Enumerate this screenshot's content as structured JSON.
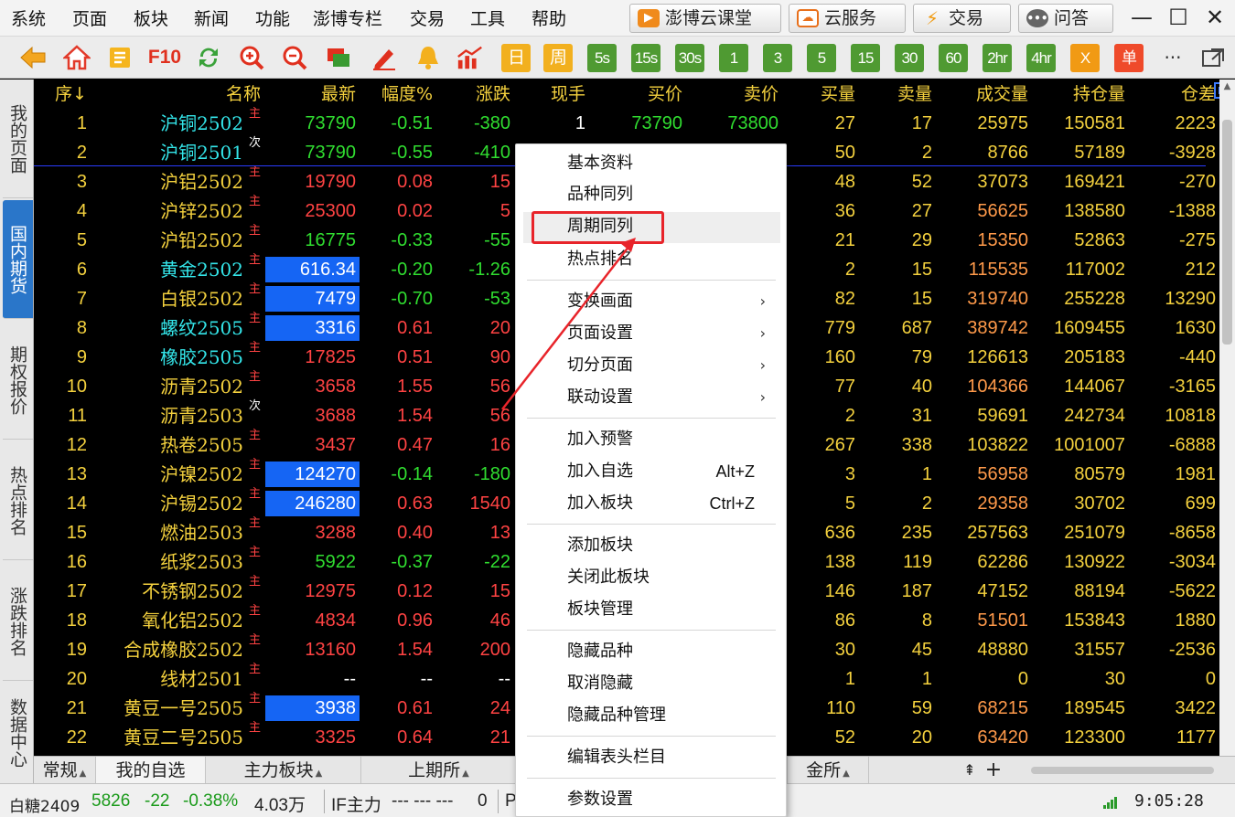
{
  "menubar": {
    "items": [
      "系统",
      "页面",
      "板块",
      "新闻",
      "功能",
      "澎博专栏",
      "交易",
      "工具",
      "帮助"
    ],
    "buttons": {
      "classroom": "澎博云课堂",
      "cloud": "云服务",
      "trade": "交易",
      "qa": "问答"
    },
    "window": {
      "minimize": "—",
      "maximize": "☐",
      "close": "✕"
    }
  },
  "toolbar": {
    "icons": [
      "back-arrow-icon",
      "home-icon",
      "news-icon",
      "f10-icon",
      "refresh-icon",
      "zoom-in-icon",
      "zoom-out-icon",
      "window-icon",
      "pen-icon",
      "alarm-bell-icon",
      "trend-icon"
    ],
    "f10": "F10",
    "periods": [
      "日",
      "周",
      "5s",
      "15s",
      "30s",
      "1",
      "3",
      "5",
      "15",
      "30",
      "60",
      "2hr",
      "4hr",
      "X",
      "单"
    ],
    "more": "···"
  },
  "sidebar": {
    "tabs": [
      "我的页面",
      "国内期货",
      "期权报价",
      "热点排名",
      "涨跌排名",
      "数据中心"
    ],
    "active": "国内期货"
  },
  "table": {
    "headers": [
      "序",
      "名称",
      "最新",
      "幅度%",
      "涨跌",
      "现手",
      "买价",
      "卖价",
      "买量",
      "卖量",
      "成交量",
      "持仓量",
      "仓差"
    ],
    "sort_indicator": "↓",
    "rows": [
      {
        "seq": "1",
        "name": "沪铜2502",
        "tag": "主",
        "last": "73790",
        "pct": "-0.51",
        "chg": "-380",
        "vol": "1",
        "bid": "73790",
        "ask": "73800",
        "bq": "27",
        "aq": "17",
        "tv": "25975",
        "oi": "150581",
        "diff": "2223"
      },
      {
        "seq": "2",
        "name": "沪铜2501",
        "tag": "次",
        "last": "73790",
        "pct": "-0.55",
        "chg": "-410",
        "vol": "",
        "bid": "",
        "ask": "",
        "bq": "50",
        "aq": "2",
        "tv": "8766",
        "oi": "57189",
        "diff": "-3928"
      },
      {
        "seq": "3",
        "name": "沪铝2502",
        "tag": "主",
        "last": "19790",
        "pct": "0.08",
        "chg": "15",
        "vol": "",
        "bid": "",
        "ask": "",
        "bq": "48",
        "aq": "52",
        "tv": "37073",
        "oi": "169421",
        "diff": "-270"
      },
      {
        "seq": "4",
        "name": "沪锌2502",
        "tag": "主",
        "last": "25300",
        "pct": "0.02",
        "chg": "5",
        "vol": "",
        "bid": "",
        "ask": "",
        "bq": "36",
        "aq": "27",
        "tv": "56625",
        "oi": "138580",
        "diff": "-1388"
      },
      {
        "seq": "5",
        "name": "沪铅2502",
        "tag": "主",
        "last": "16775",
        "pct": "-0.33",
        "chg": "-55",
        "vol": "",
        "bid": "",
        "ask": "",
        "bq": "21",
        "aq": "29",
        "tv": "15350",
        "oi": "52863",
        "diff": "-275"
      },
      {
        "seq": "6",
        "name": "黄金2502",
        "tag": "主",
        "last": "616.34",
        "pct": "-0.20",
        "chg": "-1.26",
        "vol": "",
        "bid": "",
        "ask": "",
        "bq": "2",
        "aq": "15",
        "tv": "115535",
        "oi": "117002",
        "diff": "212"
      },
      {
        "seq": "7",
        "name": "白银2502",
        "tag": "主",
        "last": "7479",
        "pct": "-0.70",
        "chg": "-53",
        "vol": "",
        "bid": "",
        "ask": "",
        "bq": "82",
        "aq": "15",
        "tv": "319740",
        "oi": "255228",
        "diff": "13290"
      },
      {
        "seq": "8",
        "name": "螺纹2505",
        "tag": "主",
        "last": "3316",
        "pct": "0.61",
        "chg": "20",
        "vol": "",
        "bid": "",
        "ask": "",
        "bq": "779",
        "aq": "687",
        "tv": "389742",
        "oi": "1609455",
        "diff": "1630"
      },
      {
        "seq": "9",
        "name": "橡胶2505",
        "tag": "主",
        "last": "17825",
        "pct": "0.51",
        "chg": "90",
        "vol": "",
        "bid": "",
        "ask": "",
        "bq": "160",
        "aq": "79",
        "tv": "126613",
        "oi": "205183",
        "diff": "-440"
      },
      {
        "seq": "10",
        "name": "沥青2502",
        "tag": "主",
        "last": "3658",
        "pct": "1.55",
        "chg": "56",
        "vol": "",
        "bid": "",
        "ask": "",
        "bq": "77",
        "aq": "40",
        "tv": "104366",
        "oi": "144067",
        "diff": "-3165"
      },
      {
        "seq": "11",
        "name": "沥青2503",
        "tag": "次",
        "last": "3688",
        "pct": "1.54",
        "chg": "56",
        "vol": "",
        "bid": "",
        "ask": "",
        "bq": "2",
        "aq": "31",
        "tv": "59691",
        "oi": "242734",
        "diff": "10818"
      },
      {
        "seq": "12",
        "name": "热卷2505",
        "tag": "主",
        "last": "3437",
        "pct": "0.47",
        "chg": "16",
        "vol": "",
        "bid": "",
        "ask": "",
        "bq": "267",
        "aq": "338",
        "tv": "103822",
        "oi": "1001007",
        "diff": "-6888"
      },
      {
        "seq": "13",
        "name": "沪镍2502",
        "tag": "主",
        "last": "124270",
        "pct": "-0.14",
        "chg": "-180",
        "vol": "",
        "bid": "",
        "ask": "",
        "bq": "3",
        "aq": "1",
        "tv": "56958",
        "oi": "80579",
        "diff": "1981"
      },
      {
        "seq": "14",
        "name": "沪锡2502",
        "tag": "主",
        "last": "246280",
        "pct": "0.63",
        "chg": "1540",
        "vol": "",
        "bid": "",
        "ask": "",
        "bq": "5",
        "aq": "2",
        "tv": "29358",
        "oi": "30702",
        "diff": "699"
      },
      {
        "seq": "15",
        "name": "燃油2503",
        "tag": "主",
        "last": "3288",
        "pct": "0.40",
        "chg": "13",
        "vol": "",
        "bid": "",
        "ask": "",
        "bq": "636",
        "aq": "235",
        "tv": "257563",
        "oi": "251079",
        "diff": "-8658"
      },
      {
        "seq": "16",
        "name": "纸浆2503",
        "tag": "主",
        "last": "5922",
        "pct": "-0.37",
        "chg": "-22",
        "vol": "",
        "bid": "",
        "ask": "",
        "bq": "138",
        "aq": "119",
        "tv": "62286",
        "oi": "130922",
        "diff": "-3034"
      },
      {
        "seq": "17",
        "name": "不锈钢2502",
        "tag": "主",
        "last": "12975",
        "pct": "0.12",
        "chg": "15",
        "vol": "",
        "bid": "",
        "ask": "",
        "bq": "146",
        "aq": "187",
        "tv": "47152",
        "oi": "88194",
        "diff": "-5622"
      },
      {
        "seq": "18",
        "name": "氧化铝2502",
        "tag": "主",
        "last": "4834",
        "pct": "0.96",
        "chg": "46",
        "vol": "",
        "bid": "",
        "ask": "",
        "bq": "86",
        "aq": "8",
        "tv": "51501",
        "oi": "153843",
        "diff": "1880"
      },
      {
        "seq": "19",
        "name": "合成橡胶2502",
        "tag": "主",
        "last": "13160",
        "pct": "1.54",
        "chg": "200",
        "vol": "",
        "bid": "",
        "ask": "",
        "bq": "30",
        "aq": "45",
        "tv": "48880",
        "oi": "31557",
        "diff": "-2536"
      },
      {
        "seq": "20",
        "name": "线材2501",
        "tag": "主",
        "last": "--",
        "pct": "--",
        "chg": "--",
        "vol": "",
        "bid": "",
        "ask": "",
        "bq": "1",
        "aq": "1",
        "tv": "0",
        "oi": "30",
        "diff": "0"
      },
      {
        "seq": "21",
        "name": "黄豆一号2505",
        "tag": "主",
        "last": "3938",
        "pct": "0.61",
        "chg": "24",
        "vol": "",
        "bid": "",
        "ask": "",
        "bq": "110",
        "aq": "59",
        "tv": "68215",
        "oi": "189545",
        "diff": "3422"
      },
      {
        "seq": "22",
        "name": "黄豆二号2505",
        "tag": "主",
        "last": "3325",
        "pct": "0.64",
        "chg": "21",
        "vol": "",
        "bid": "",
        "ask": "",
        "bq": "52",
        "aq": "20",
        "tv": "63420",
        "oi": "123300",
        "diff": "1177"
      }
    ],
    "highlighted_seq": [
      "6",
      "7",
      "8",
      "13",
      "14",
      "21"
    ],
    "name_cyan_seq": [
      "1",
      "2",
      "6",
      "8",
      "9"
    ],
    "tv_orange_seq": [
      "4",
      "5",
      "6",
      "7",
      "8",
      "10",
      "13",
      "14",
      "18",
      "21",
      "22"
    ]
  },
  "bottom_tabs": [
    {
      "label": "常规",
      "arrow": "▲"
    },
    {
      "label": "我的自选",
      "arrow": ""
    },
    {
      "label": "主力板块",
      "arrow": "▲"
    },
    {
      "label": "上期所",
      "arrow": "▲"
    },
    {
      "label": "金所",
      "arrow": "▲"
    }
  ],
  "bottom_controls": {
    "up": "⇞",
    "add": "+"
  },
  "statusbar": {
    "symbol": "白糖2409",
    "price": "5826",
    "change": "-22",
    "change_pct": "-0.38%",
    "volume": "4.03万",
    "if_label": "IF主力",
    "if_values": "---  ---  ---",
    "if_zero": "0",
    "p_label": "P",
    "signal": "Tall",
    "clock": "9:05:28"
  },
  "context_menu": {
    "items": [
      {
        "label": "基本资料",
        "shortcut": "",
        "submenu": false
      },
      {
        "label": "品种同列",
        "shortcut": "",
        "submenu": false
      },
      {
        "label": "周期同列",
        "shortcut": "",
        "submenu": false
      },
      {
        "label": "热点排名",
        "shortcut": "",
        "submenu": false
      },
      {
        "label": "变换画面",
        "shortcut": "",
        "submenu": true
      },
      {
        "label": "页面设置",
        "shortcut": "",
        "submenu": true
      },
      {
        "label": "切分页面",
        "shortcut": "",
        "submenu": true
      },
      {
        "label": "联动设置",
        "shortcut": "",
        "submenu": true
      },
      {
        "label": "加入预警",
        "shortcut": "",
        "submenu": false
      },
      {
        "label": "加入自选",
        "shortcut": "Alt+Z",
        "submenu": false
      },
      {
        "label": "加入板块",
        "shortcut": "Ctrl+Z",
        "submenu": false
      },
      {
        "label": "添加板块",
        "shortcut": "",
        "submenu": false
      },
      {
        "label": "关闭此板块",
        "shortcut": "",
        "submenu": false
      },
      {
        "label": "板块管理",
        "shortcut": "",
        "submenu": false
      },
      {
        "label": "隐藏品种",
        "shortcut": "",
        "submenu": false
      },
      {
        "label": "取消隐藏",
        "shortcut": "",
        "submenu": false
      },
      {
        "label": "隐藏品种管理",
        "shortcut": "",
        "submenu": false
      },
      {
        "label": "编辑表头栏目",
        "shortcut": "",
        "submenu": false
      },
      {
        "label": "参数设置",
        "shortcut": "",
        "submenu": false
      }
    ],
    "highlighted": "周期同列",
    "submenu_arrow": "›"
  },
  "colors": {
    "up": "#ff4343",
    "down": "#30dd30",
    "neutral": "#ffffff",
    "name_yellow": "#f4d13e",
    "name_cyan": "#34e6ea",
    "orange": "#ff9a4a",
    "highlight_bg": "#1565f4",
    "annotation_red": "#e8242a",
    "sidebar_active": "#2a76c9"
  }
}
